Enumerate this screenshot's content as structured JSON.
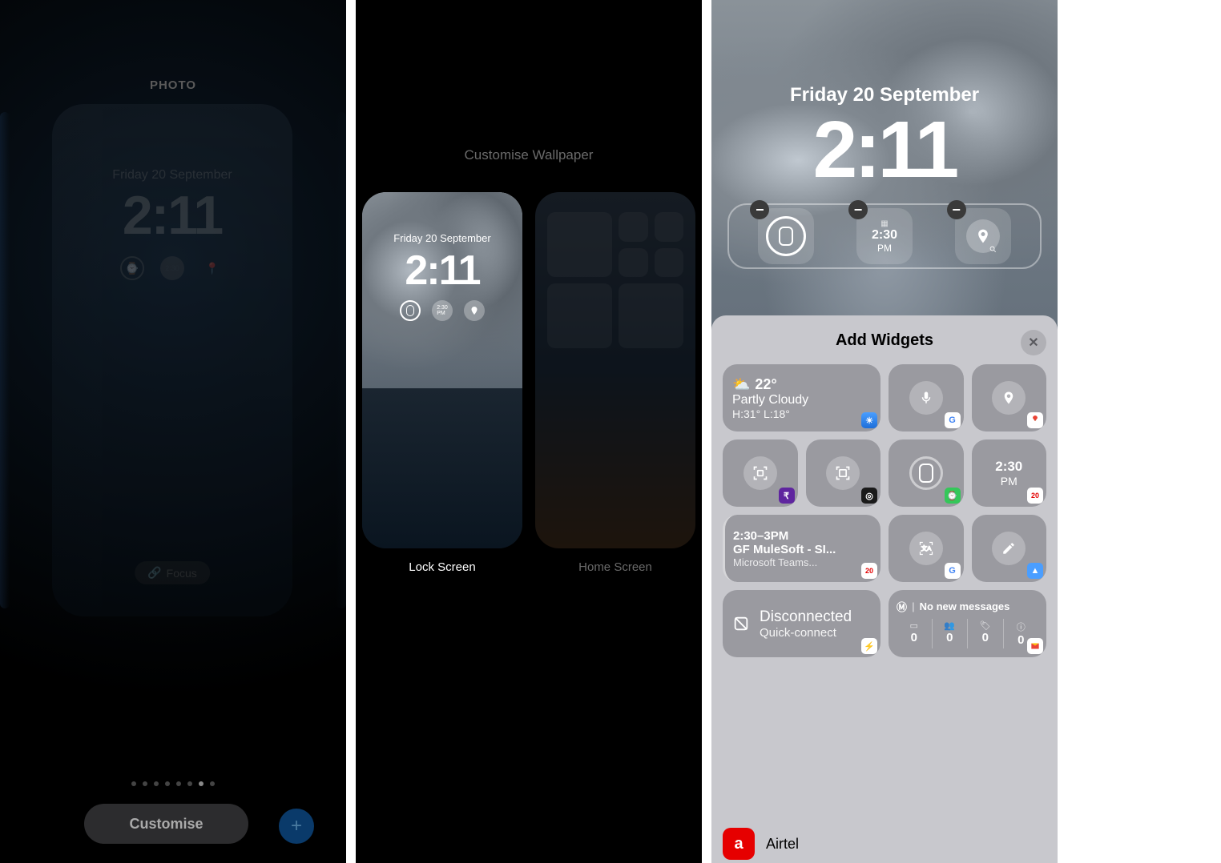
{
  "panel1": {
    "title": "PHOTO",
    "date": "Friday 20 September",
    "time": "2:11",
    "focus_label": "Focus",
    "customise_label": "Customise",
    "dot_active_index": 6,
    "dot_count": 8
  },
  "panel2": {
    "title": "Customise Wallpaper",
    "date": "Friday 20 September",
    "time": "2:11",
    "lock_label": "Lock Screen",
    "home_label": "Home Screen"
  },
  "panel3": {
    "date": "Friday 20 September",
    "time": "2:11",
    "sheet_title": "Add Widgets",
    "slot2_time": "2:30",
    "slot2_ampm": "PM",
    "weather": {
      "temp": "22°",
      "desc": "Partly Cloudy",
      "hl": "H:31° L:18°"
    },
    "clock": {
      "time": "2:30",
      "ampm": "PM"
    },
    "calendar": {
      "time": "2:30–3PM",
      "title": "GF MuleSoft - SI...",
      "subtitle": "Microsoft Teams..."
    },
    "disconnect": {
      "title": "Disconnected",
      "subtitle": "Quick-connect"
    },
    "gmail": {
      "header": "No new messages",
      "c1": "0",
      "c2": "0",
      "c3": "0",
      "c4": "0"
    },
    "airtel": "Airtel"
  }
}
